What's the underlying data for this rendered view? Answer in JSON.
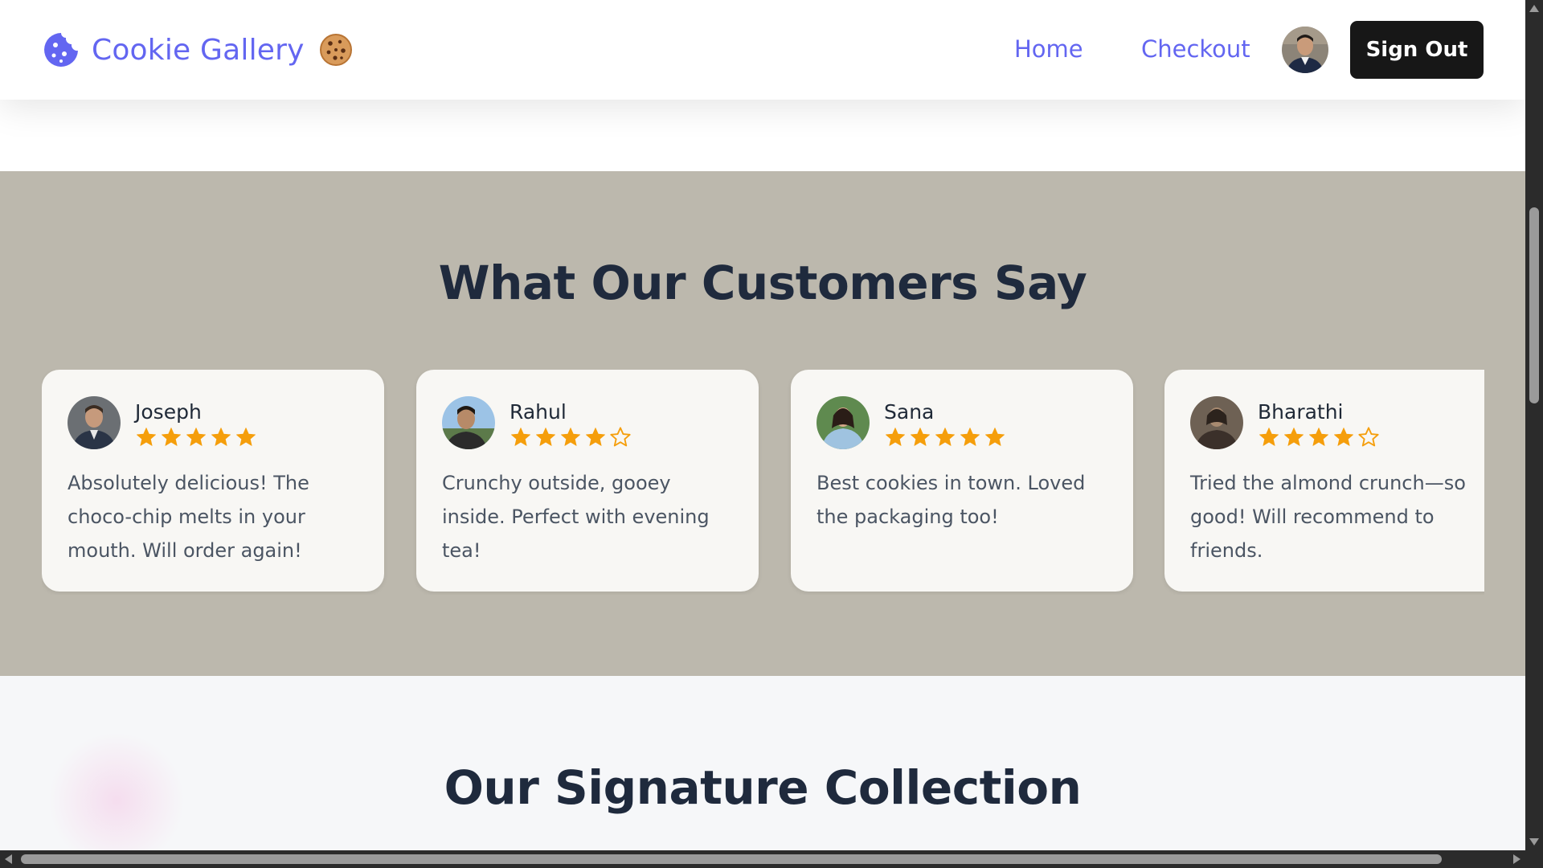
{
  "header": {
    "brand": "Cookie Gallery",
    "brand_icon": "cookie-logo-icon",
    "brand_emoji": "cookie-emoji-icon",
    "nav": {
      "home": "Home",
      "checkout": "Checkout"
    },
    "user_avatar": "user-avatar",
    "sign_out": "Sign Out"
  },
  "testimonials": {
    "title": "What Our Customers Say",
    "items": [
      {
        "name": "Joseph",
        "rating": 5,
        "text": "Absolutely delicious! The choco-chip melts in your mouth. Will order again!"
      },
      {
        "name": "Rahul",
        "rating": 4,
        "text": "Crunchy outside, gooey inside. Perfect with evening tea!"
      },
      {
        "name": "Sana",
        "rating": 5,
        "text": "Best cookies in town. Loved the packaging too!"
      },
      {
        "name": "Bharathi",
        "rating": 4,
        "text": "Tried the almond crunch—so good! Will recommend to friends."
      }
    ]
  },
  "signature": {
    "title": "Our Signature Collection"
  },
  "colors": {
    "accent": "#6366f1",
    "testimonial_bg": "#bcb8ad",
    "card_bg": "#f8f7f4",
    "star": "#f59e0b",
    "button_bg": "#171717",
    "heading": "#1f2a3d"
  }
}
